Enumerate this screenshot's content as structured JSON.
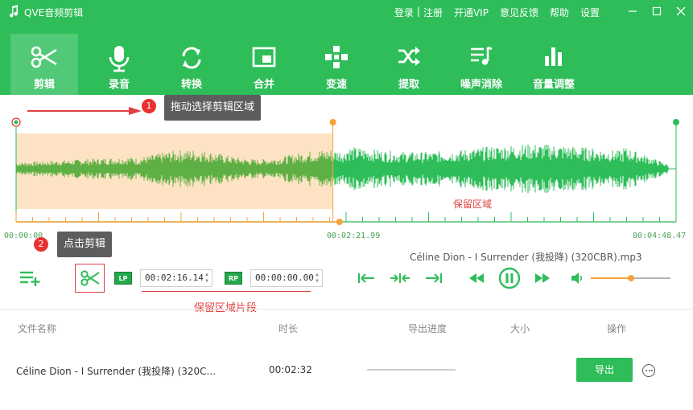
{
  "app": {
    "title": "QVE音频剪辑"
  },
  "topmenu": {
    "login": "登录",
    "separator": "|",
    "register": "注册",
    "vip": "开通VIP",
    "feedback": "意见反馈",
    "help": "帮助",
    "settings": "设置"
  },
  "toolbar": {
    "items": [
      {
        "label": "剪辑",
        "icon": "scissors-icon"
      },
      {
        "label": "录音",
        "icon": "microphone-icon"
      },
      {
        "label": "转换",
        "icon": "convert-icon"
      },
      {
        "label": "合并",
        "icon": "merge-icon"
      },
      {
        "label": "变速",
        "icon": "speed-icon"
      },
      {
        "label": "提取",
        "icon": "shuffle-icon"
      },
      {
        "label": "噪声消除",
        "icon": "noise-icon"
      },
      {
        "label": "音量调整",
        "icon": "volume-bars-icon"
      }
    ]
  },
  "waveform": {
    "tip1_number": "1",
    "tip1_text": "拖动选择剪辑区域",
    "tip2_number": "2",
    "tip2_text": "点击剪辑",
    "keep_label": "保留区域",
    "start_time": "00:00:00",
    "cursor_time": "00:02:21.99",
    "end_time": "00:04:48.47",
    "selection_fraction": 0.48,
    "cursor_fraction": 0.49
  },
  "controls": {
    "file_name": "Céline Dion - I Surrender (我投降) (320CBR).mp3",
    "lp_label": "LP",
    "rp_label": "RP",
    "lp_time": "00:02:16.14",
    "rp_time": "00:00:00.00",
    "segment_label": "保留区域片段",
    "volume_fraction": 0.5
  },
  "table": {
    "headers": {
      "name": "文件名称",
      "duration": "时长",
      "progress": "导出进度",
      "size": "大小",
      "action": "操作"
    },
    "rows": [
      {
        "name": "Céline Dion - I Surrender (我投降) (320C...",
        "duration": "00:02:32",
        "export_label": "导出"
      }
    ]
  },
  "colors": {
    "brand": "#2ebd59",
    "accent": "#f5a33b",
    "alert": "#e04040"
  }
}
